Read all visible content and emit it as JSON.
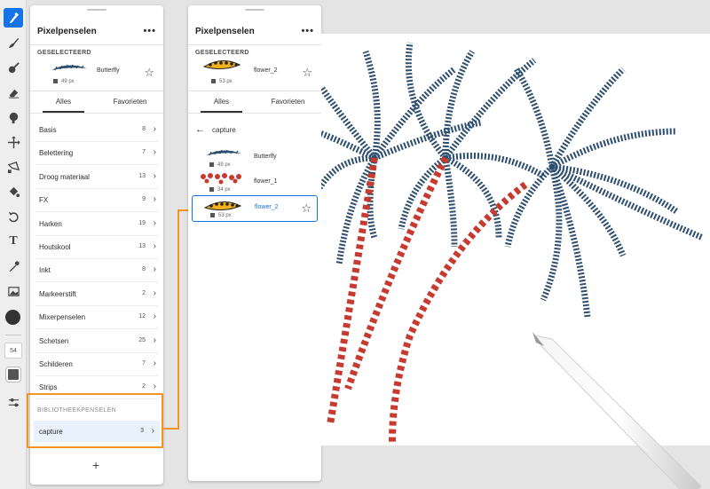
{
  "toolbar": {
    "tools": [
      "brush-active-icon",
      "paint-brush-icon",
      "blend-icon",
      "eraser-icon",
      "smudge-icon",
      "move-icon",
      "lasso-icon",
      "fill-icon",
      "undo-history-icon",
      "text-icon",
      "eyedropper-icon",
      "image-icon"
    ],
    "brush_size": "54",
    "accent": "#1473e6"
  },
  "panel1": {
    "title": "Pixelpenselen",
    "more": "•••",
    "selected_label": "GESELECTEERD",
    "selected_brush": {
      "name": "Butterfly",
      "size": "49 px"
    },
    "tabs": [
      "Alles",
      "Favorieten"
    ],
    "categories": [
      {
        "label": "Basis",
        "count": "8"
      },
      {
        "label": "Belettering",
        "count": "7"
      },
      {
        "label": "Droog materiaal",
        "count": "13"
      },
      {
        "label": "FX",
        "count": "9"
      },
      {
        "label": "Harken",
        "count": "19"
      },
      {
        "label": "Houtskool",
        "count": "13"
      },
      {
        "label": "Inkt",
        "count": "8"
      },
      {
        "label": "Markeerstift",
        "count": "2"
      },
      {
        "label": "Mixerpenselen",
        "count": "12"
      },
      {
        "label": "Schetsen",
        "count": "25"
      },
      {
        "label": "Schilderen",
        "count": "7"
      },
      {
        "label": "Strips",
        "count": "2"
      }
    ],
    "library_label": "BIBLIOTHEEKPENSELEN",
    "library": {
      "label": "capture",
      "count": "3"
    },
    "add": "+"
  },
  "panel2": {
    "title": "Pixelpenselen",
    "more": "•••",
    "selected_label": "GESELECTEERD",
    "selected_brush": {
      "name": "flower_2",
      "size": "53 px"
    },
    "tabs": [
      "Alles",
      "Favorieten"
    ],
    "back_label": "capture",
    "brushes": [
      {
        "name": "Butterfly",
        "size": "49 px"
      },
      {
        "name": "flower_1",
        "size": "34 px"
      },
      {
        "name": "flower_2",
        "size": "53 px"
      }
    ]
  },
  "colors": {
    "highlight": "#f29423",
    "selected_row": "#e8f1fc",
    "palm_leaf": "#2d4e6e",
    "flower": "#c63a30"
  }
}
